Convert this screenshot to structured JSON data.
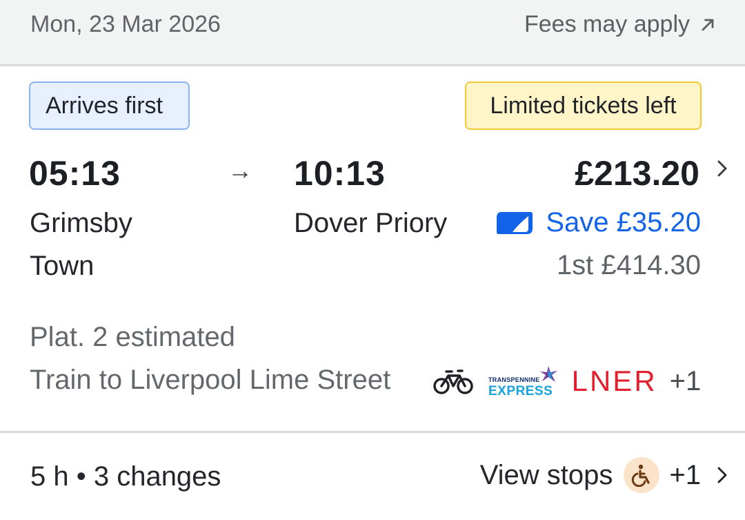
{
  "header": {
    "date": "Mon, 23 Mar 2026",
    "fees_label": "Fees may apply",
    "fees_icon": "external-arrow-icon"
  },
  "journey": {
    "badge_primary": "Arrives first",
    "badge_availability": "Limited tickets left",
    "departure_time": "05:13",
    "arrival_time": "10:13",
    "departure_station": "Grimsby Town",
    "arrival_station": "Dover Priory",
    "price": "£213.20",
    "saving": "Save £35.20",
    "first_class": "1st £414.30",
    "platform": "Plat. 2 estimated",
    "service": "Train to Liverpool Lime Street",
    "operators": {
      "tpe_small": "TRANSPENNINE",
      "tpe_big": "EXPRESS",
      "lner": "LNER",
      "more": "+1"
    },
    "summary": "5 h • 3 changes",
    "view_stops": "View stops",
    "accessibility_more": "+1"
  },
  "colors": {
    "accent_blue": "#1363e8",
    "badge_blue_bg": "#e8f0fe",
    "badge_yellow_bg": "#fff5c8",
    "lner_red": "#e1202e",
    "tpe_blue": "#17a3dc"
  }
}
